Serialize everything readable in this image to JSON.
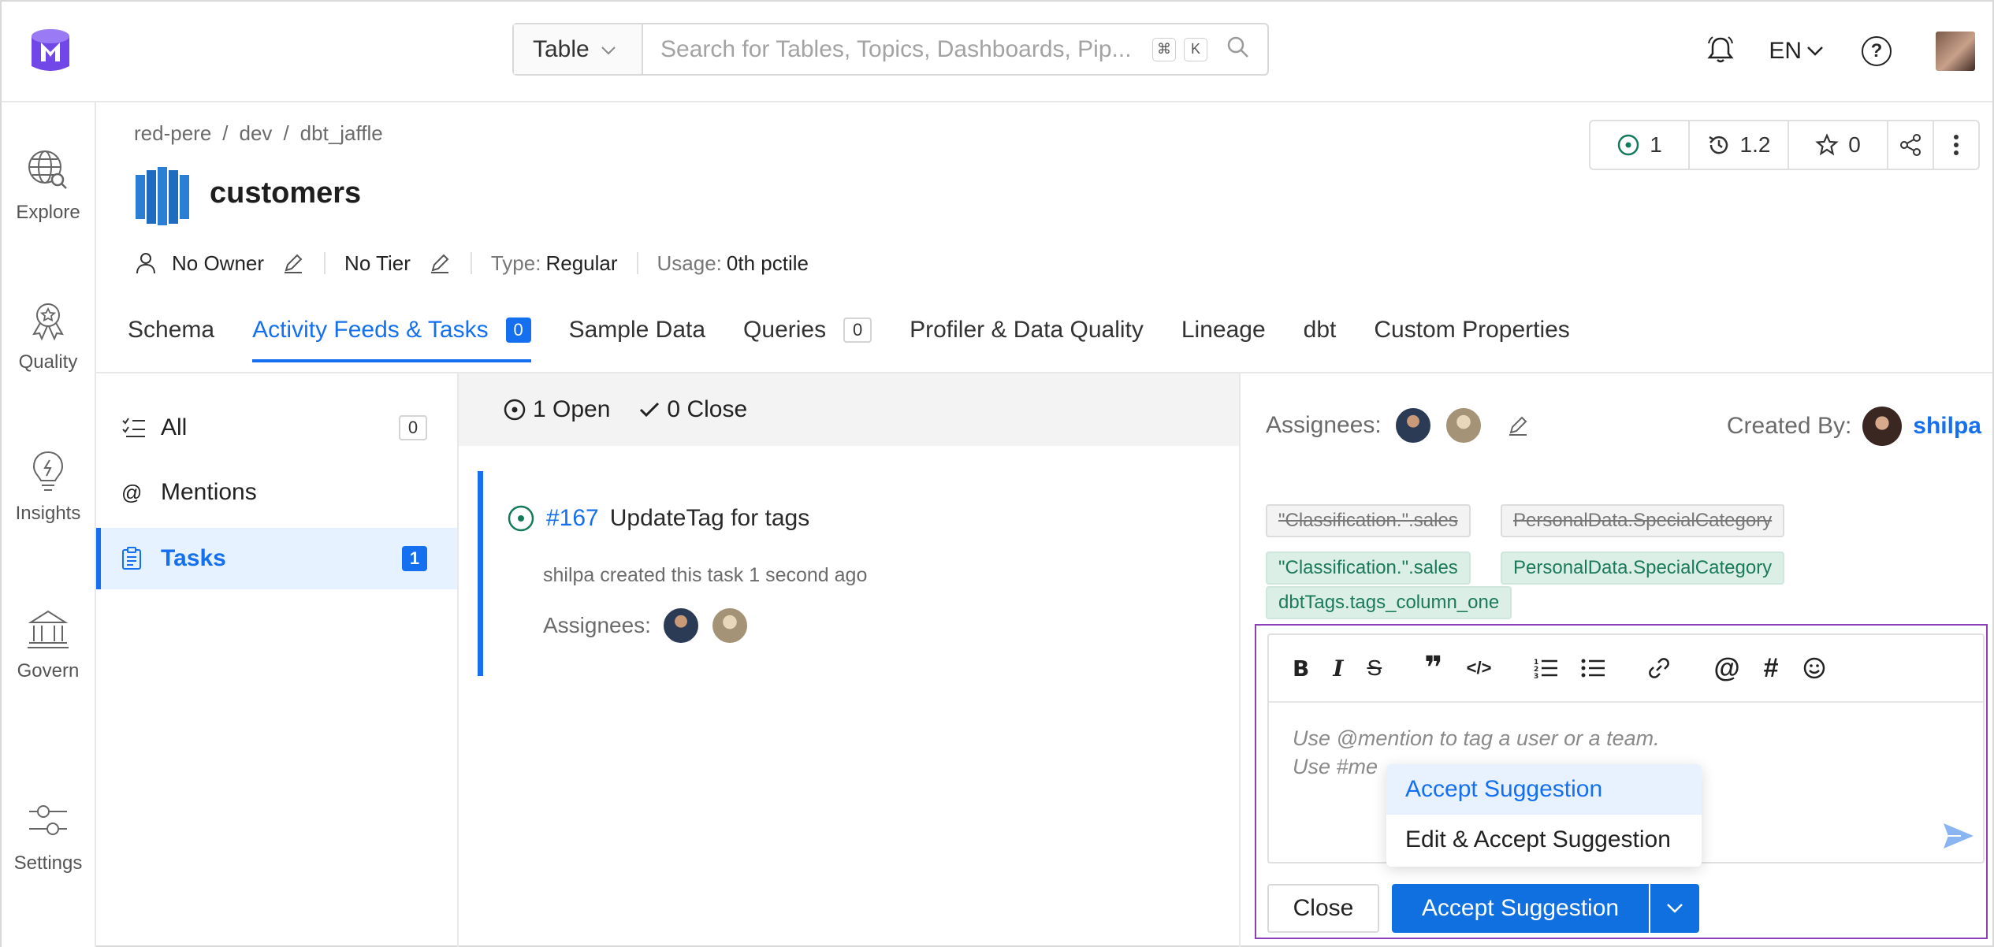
{
  "colors": {
    "accent": "#1470ef",
    "tag_new_bg": "#dcefe7",
    "tag_new_text": "#1b7a5c",
    "focus_outline": "#8b3fb8"
  },
  "topbar": {
    "search_type": "Table",
    "search_placeholder": "Search for Tables, Topics, Dashboards, Pip...",
    "kbd_cmd": "⌘",
    "kbd_k": "K",
    "language": "EN"
  },
  "leftnav": [
    {
      "label": "Explore",
      "icon": "explore-icon"
    },
    {
      "label": "Quality",
      "icon": "quality-icon"
    },
    {
      "label": "Insights",
      "icon": "insights-icon"
    },
    {
      "label": "Govern",
      "icon": "govern-icon"
    },
    {
      "label": "Settings",
      "icon": "settings-icon"
    }
  ],
  "breadcrumb": [
    "red-pere",
    "dev",
    "dbt_jaffle"
  ],
  "entity": {
    "name": "customers",
    "owner": "No Owner",
    "tier": "No Tier",
    "type_key": "Type:",
    "type_value": "Regular",
    "usage_key": "Usage:",
    "usage_value": "0th pctile"
  },
  "actions": {
    "tasks": "1",
    "version": "1.2",
    "stars": "0"
  },
  "tabs": [
    {
      "label": "Schema"
    },
    {
      "label": "Activity Feeds & Tasks",
      "badge": "0"
    },
    {
      "label": "Sample Data"
    },
    {
      "label": "Queries",
      "badge": "0"
    },
    {
      "label": "Profiler & Data Quality"
    },
    {
      "label": "Lineage"
    },
    {
      "label": "dbt"
    },
    {
      "label": "Custom Properties"
    }
  ],
  "filters": [
    {
      "label": "All",
      "count": "0"
    },
    {
      "label": "Mentions"
    },
    {
      "label": "Tasks",
      "count": "1"
    }
  ],
  "task_status": {
    "open": "1 Open",
    "closed": "0 Close"
  },
  "task": {
    "id": "#167",
    "title": "UpdateTag for tags",
    "subtitle": "shilpa created this task 1 second ago",
    "assignees_label": "Assignees:"
  },
  "details": {
    "assignees_label": "Assignees:",
    "created_by_label": "Created By:",
    "created_by": "shilpa",
    "old_tags": [
      "\"Classification.\".sales",
      "PersonalData.SpecialCategory"
    ],
    "new_tags": [
      "\"Classification.\".sales",
      "PersonalData.SpecialCategory",
      "dbtTags.tags_column_one"
    ]
  },
  "editor": {
    "placeholder_line1": "Use @mention to tag a user or a team.",
    "placeholder_line2": "Use #me"
  },
  "dropdown": [
    "Accept Suggestion",
    "Edit & Accept Suggestion"
  ],
  "buttons": {
    "close": "Close",
    "accept": "Accept Suggestion"
  }
}
